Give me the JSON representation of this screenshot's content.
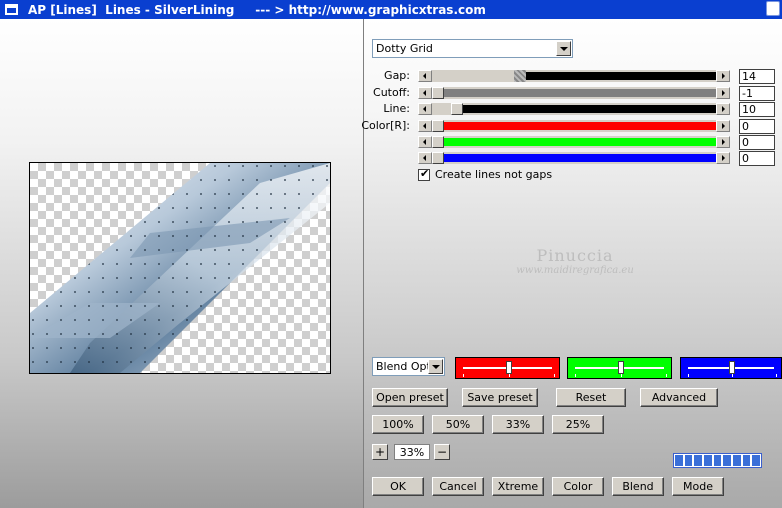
{
  "window": {
    "title": "AP [Lines]  Lines - SilverLining     --- > http://www.graphicxtras.com",
    "icons": {
      "system": "window-menu-icon",
      "close": "close-icon"
    }
  },
  "preset_select": {
    "value": "Dotty Grid"
  },
  "params": [
    {
      "label": "Gap:",
      "value": "14",
      "fill_color": "#000000",
      "level": 0.3
    },
    {
      "label": "Cutoff:",
      "value": "-1",
      "fill_color": "#808080",
      "level": 0.0
    },
    {
      "label": "Line:",
      "value": "10",
      "fill_color": "#000000",
      "level": 0.07
    },
    {
      "label": "Color[R]:",
      "value": "0",
      "fill_color": "#ff0000",
      "level": 0.0
    },
    {
      "label": "",
      "value": "0",
      "fill_color": "#00ff00",
      "level": 0.0
    },
    {
      "label": "",
      "value": "0",
      "fill_color": "#0000ff",
      "level": 0.0
    }
  ],
  "checkbox": {
    "label": "Create lines not gaps",
    "checked": true
  },
  "watermark": {
    "line1": "Pinuccia",
    "line2": "www.maidiregrafica.eu"
  },
  "blend_select": {
    "value": "Blend Optio"
  },
  "color_sliders": [
    {
      "color": "#ff0000",
      "level": 0.5
    },
    {
      "color": "#00ff00",
      "level": 0.5
    },
    {
      "color": "#0000ff",
      "level": 0.5
    }
  ],
  "preset_buttons": {
    "open": "Open preset",
    "save": "Save preset",
    "reset": "Reset",
    "advanced": "Advanced"
  },
  "zoom_buttons": [
    "100%",
    "50%",
    "33%",
    "25%"
  ],
  "zoom": {
    "plus": "+",
    "minus": "−",
    "value": "33%"
  },
  "bottom_buttons": [
    "OK",
    "Cancel",
    "Xtreme",
    "Color",
    "Blend",
    "Mode"
  ],
  "progress": {
    "segments": 9,
    "filled": 9
  }
}
